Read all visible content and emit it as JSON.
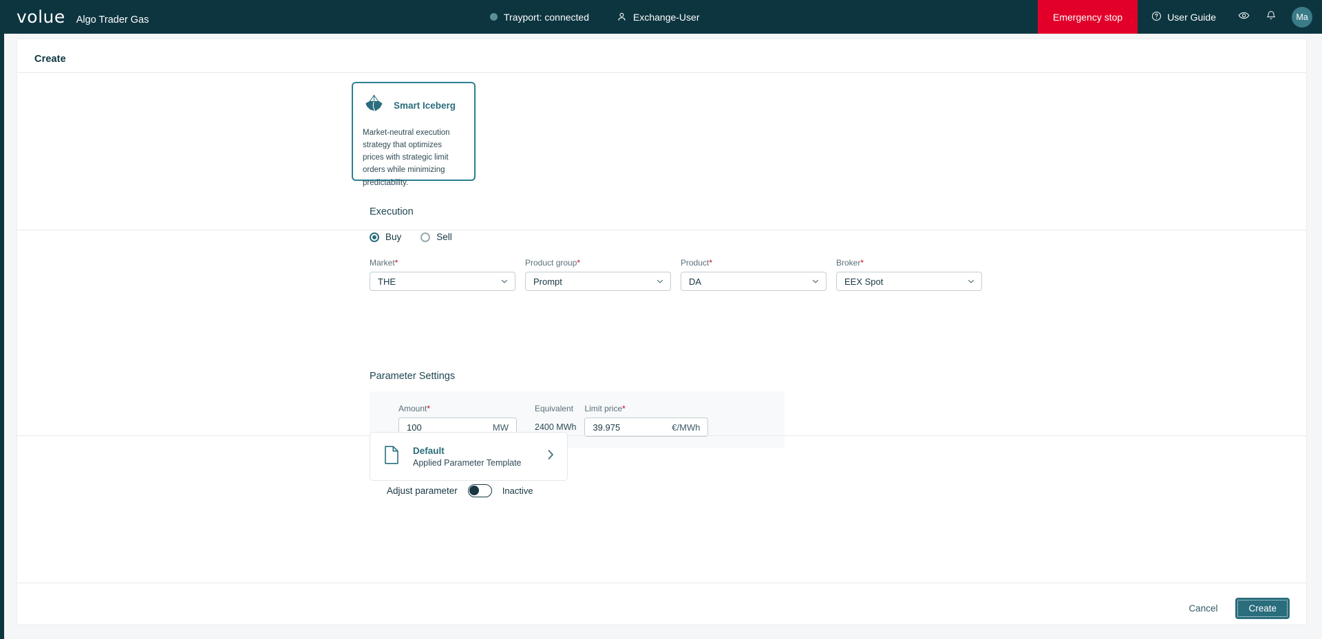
{
  "header": {
    "logo": "volue",
    "app_name": "Algo Trader Gas",
    "connection_status": "Trayport: connected",
    "connection_dot_color": "#5d8f96",
    "user_role": "Exchange-User",
    "emergency_stop": "Emergency stop",
    "emergency_color": "#e2002a",
    "user_guide": "User Guide",
    "avatar_initials": "Ma",
    "avatar_color": "#3b7b88",
    "bar_color": "#0d3540",
    "icons": {
      "person": "person-icon",
      "help": "help-circle-icon",
      "eye": "eye-icon",
      "bell": "bell-icon"
    }
  },
  "page": {
    "title": "Create"
  },
  "strategy": {
    "name": "Smart Iceberg",
    "description": "Market-neutral execution strategy that optimizes prices with strategic limit orders while minimizing predictability.",
    "icon": "iceberg-icon",
    "selected": true,
    "accent_color": "#2a7f8f"
  },
  "execution": {
    "heading": "Execution",
    "side_options": [
      {
        "label": "Buy",
        "selected": true
      },
      {
        "label": "Sell",
        "selected": false
      }
    ],
    "fields": [
      {
        "label": "Market",
        "required": true,
        "value": "THE"
      },
      {
        "label": "Product group",
        "required": true,
        "value": "Prompt"
      },
      {
        "label": "Product",
        "required": true,
        "value": "DA"
      },
      {
        "label": "Broker",
        "required": true,
        "value": "EEX Spot"
      }
    ],
    "amount": {
      "label": "Amount",
      "required": true,
      "value": "100",
      "unit": "MW"
    },
    "equivalent": {
      "label": "Equivalent",
      "value": "2400 MWh"
    },
    "limit_price": {
      "label": "Limit price",
      "required": true,
      "value": "39.975",
      "unit": "€/MWh"
    }
  },
  "parameter_settings": {
    "heading": "Parameter Settings",
    "template": {
      "title": "Default",
      "subtitle": "Applied Parameter Template",
      "icon": "document-icon",
      "chevron": "chevron-right-icon"
    },
    "adjust": {
      "label": "Adjust parameter",
      "state": "Inactive",
      "on": false
    }
  },
  "footer": {
    "cancel": "Cancel",
    "create": "Create",
    "create_color": "#2a6d7c"
  }
}
